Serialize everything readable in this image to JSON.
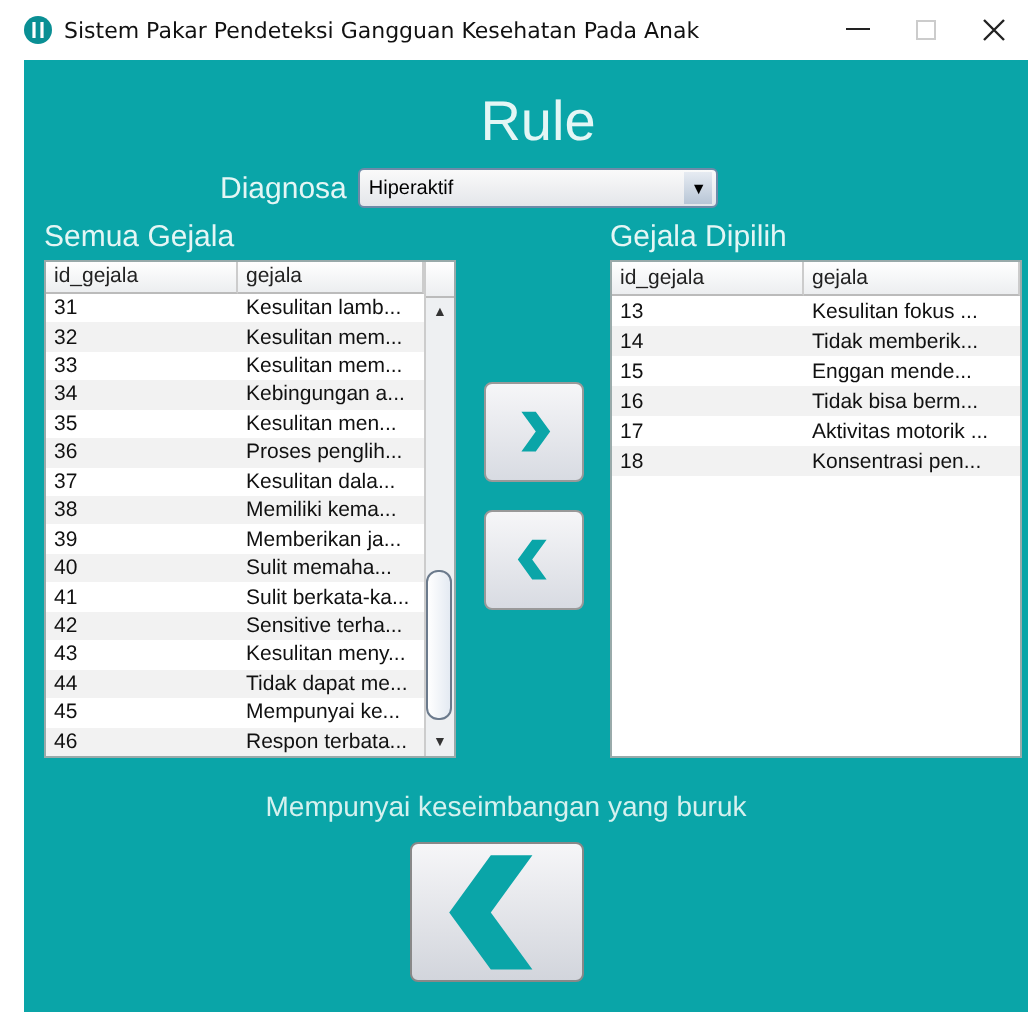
{
  "window": {
    "title": "Sistem Pakar Pendeteksi Gangguan Kesehatan Pada Anak"
  },
  "heading": "Rule",
  "diagnosa": {
    "label": "Diagnosa",
    "value": "Hiperaktif",
    "arrow": "▼"
  },
  "all_symptoms": {
    "title": "Semua Gejala",
    "columns": [
      "id_gejala",
      "gejala"
    ],
    "scroll_up": "▲",
    "scroll_down": "▼",
    "rows": [
      [
        "31",
        "Kesulitan lamb..."
      ],
      [
        "32",
        "Kesulitan mem..."
      ],
      [
        "33",
        "Kesulitan mem..."
      ],
      [
        "34",
        "Kebingungan a..."
      ],
      [
        "35",
        "Kesulitan men..."
      ],
      [
        "36",
        "Proses penglih..."
      ],
      [
        "37",
        "Kesulitan dala..."
      ],
      [
        "38",
        "Memiliki kema..."
      ],
      [
        "39",
        "Memberikan ja..."
      ],
      [
        "40",
        "Sulit memaha..."
      ],
      [
        "41",
        "Sulit berkata-ka..."
      ],
      [
        "42",
        "Sensitive terha..."
      ],
      [
        "43",
        "Kesulitan meny..."
      ],
      [
        "44",
        "Tidak dapat me..."
      ],
      [
        "45",
        "Mempunyai ke..."
      ],
      [
        "46",
        "Respon terbata..."
      ]
    ]
  },
  "selected_symptoms": {
    "title": "Gejala Dipilih",
    "columns": [
      "id_gejala",
      "gejala"
    ],
    "rows": [
      [
        "13",
        "Kesulitan fokus ..."
      ],
      [
        "14",
        "Tidak memberik..."
      ],
      [
        "15",
        "Enggan  mende..."
      ],
      [
        "16",
        "Tidak bisa berm..."
      ],
      [
        "17",
        "Aktivitas motorik ..."
      ],
      [
        "18",
        "Konsentrasi pen..."
      ]
    ]
  },
  "status_text": "Mempunyai keseimbangan yang buruk"
}
